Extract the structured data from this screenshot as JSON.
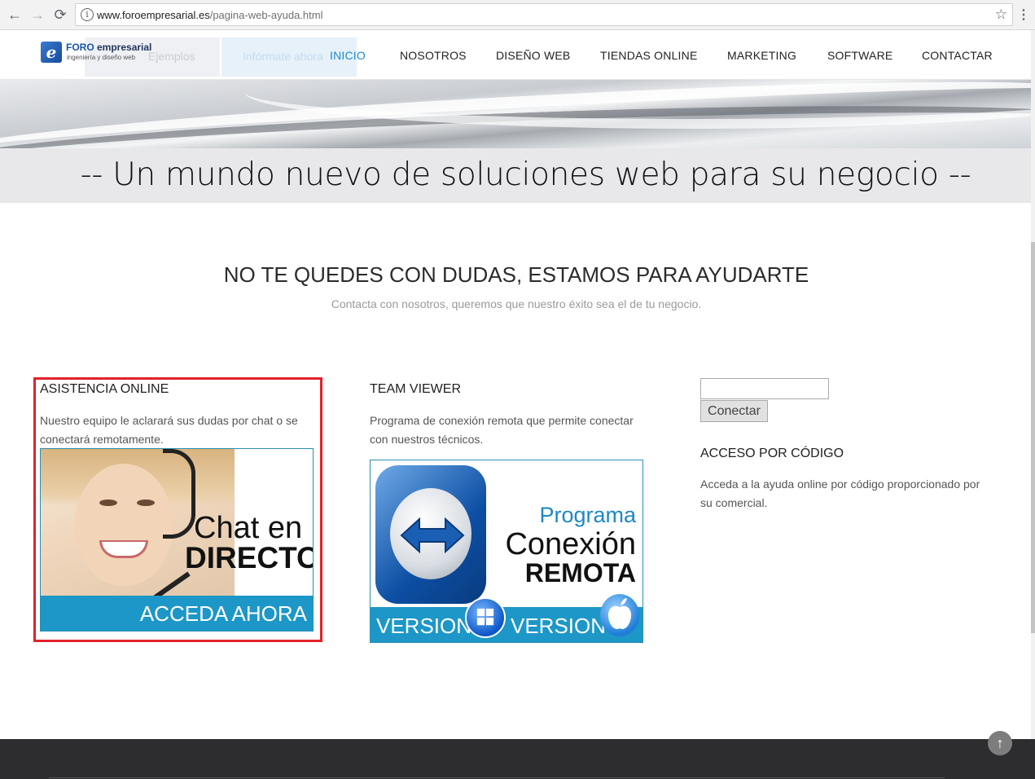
{
  "browser": {
    "back_icon": "←",
    "forward_icon": "→",
    "reload_icon": "⟳",
    "url_domain": "www.foroempresarial.es",
    "url_path": "/pagina-web-ayuda.html",
    "info_icon": "i",
    "star_icon": "☆",
    "menu_icon": "⋮"
  },
  "header": {
    "logo_mark": "e",
    "logo_name_1": "FORO",
    "logo_name_2": " empresarial",
    "logo_sub": "ingeniería y diseño web",
    "ghost_btn_1": "Ejemplos",
    "ghost_btn_2": "Infórmate ahora",
    "nav": [
      "INICIO",
      "NOSOTROS",
      "DISEÑO WEB",
      "TIENDAS ONLINE",
      "MARKETING",
      "SOFTWARE",
      "CONTACTAR"
    ],
    "active_color": "#1a8ad1"
  },
  "hero": {
    "tagline": "-- Un mundo nuevo de soluciones web para su negocio --"
  },
  "section": {
    "title": "NO TE QUEDES CON DUDAS, ESTAMOS PARA AYUDARTE",
    "subtitle": "Contacta con nosotros, queremos que nuestro éxito sea el de tu negocio."
  },
  "col_online": {
    "title": "ASISTENCIA ONLINE",
    "text": "Nuestro equipo le aclarará sus dudas por chat o se conectará remotamente.",
    "banner_line1": "Chat en",
    "banner_line2": "DIRECTO",
    "banner_cta": "ACCEDA AHORA"
  },
  "col_tv": {
    "title": "TEAM VIEWER",
    "text": "Programa de conexión remota que permite conectar con nuestros técnicos.",
    "banner_line1": "Programa",
    "banner_line2": "Conexión",
    "banner_line3": "REMOTA",
    "version_1": "VERSION",
    "version_2": "VERSION"
  },
  "col_code": {
    "input_value": "",
    "button": "Conectar",
    "title": "ACCESO POR CÓDIGO",
    "text": "Acceda a la ayuda online por código proporcionado por su comercial."
  },
  "footer": {
    "scroll_top_icon": "↑"
  },
  "colors": {
    "highlight_border": "#e0222a",
    "banner_blue": "#1d97c7"
  }
}
